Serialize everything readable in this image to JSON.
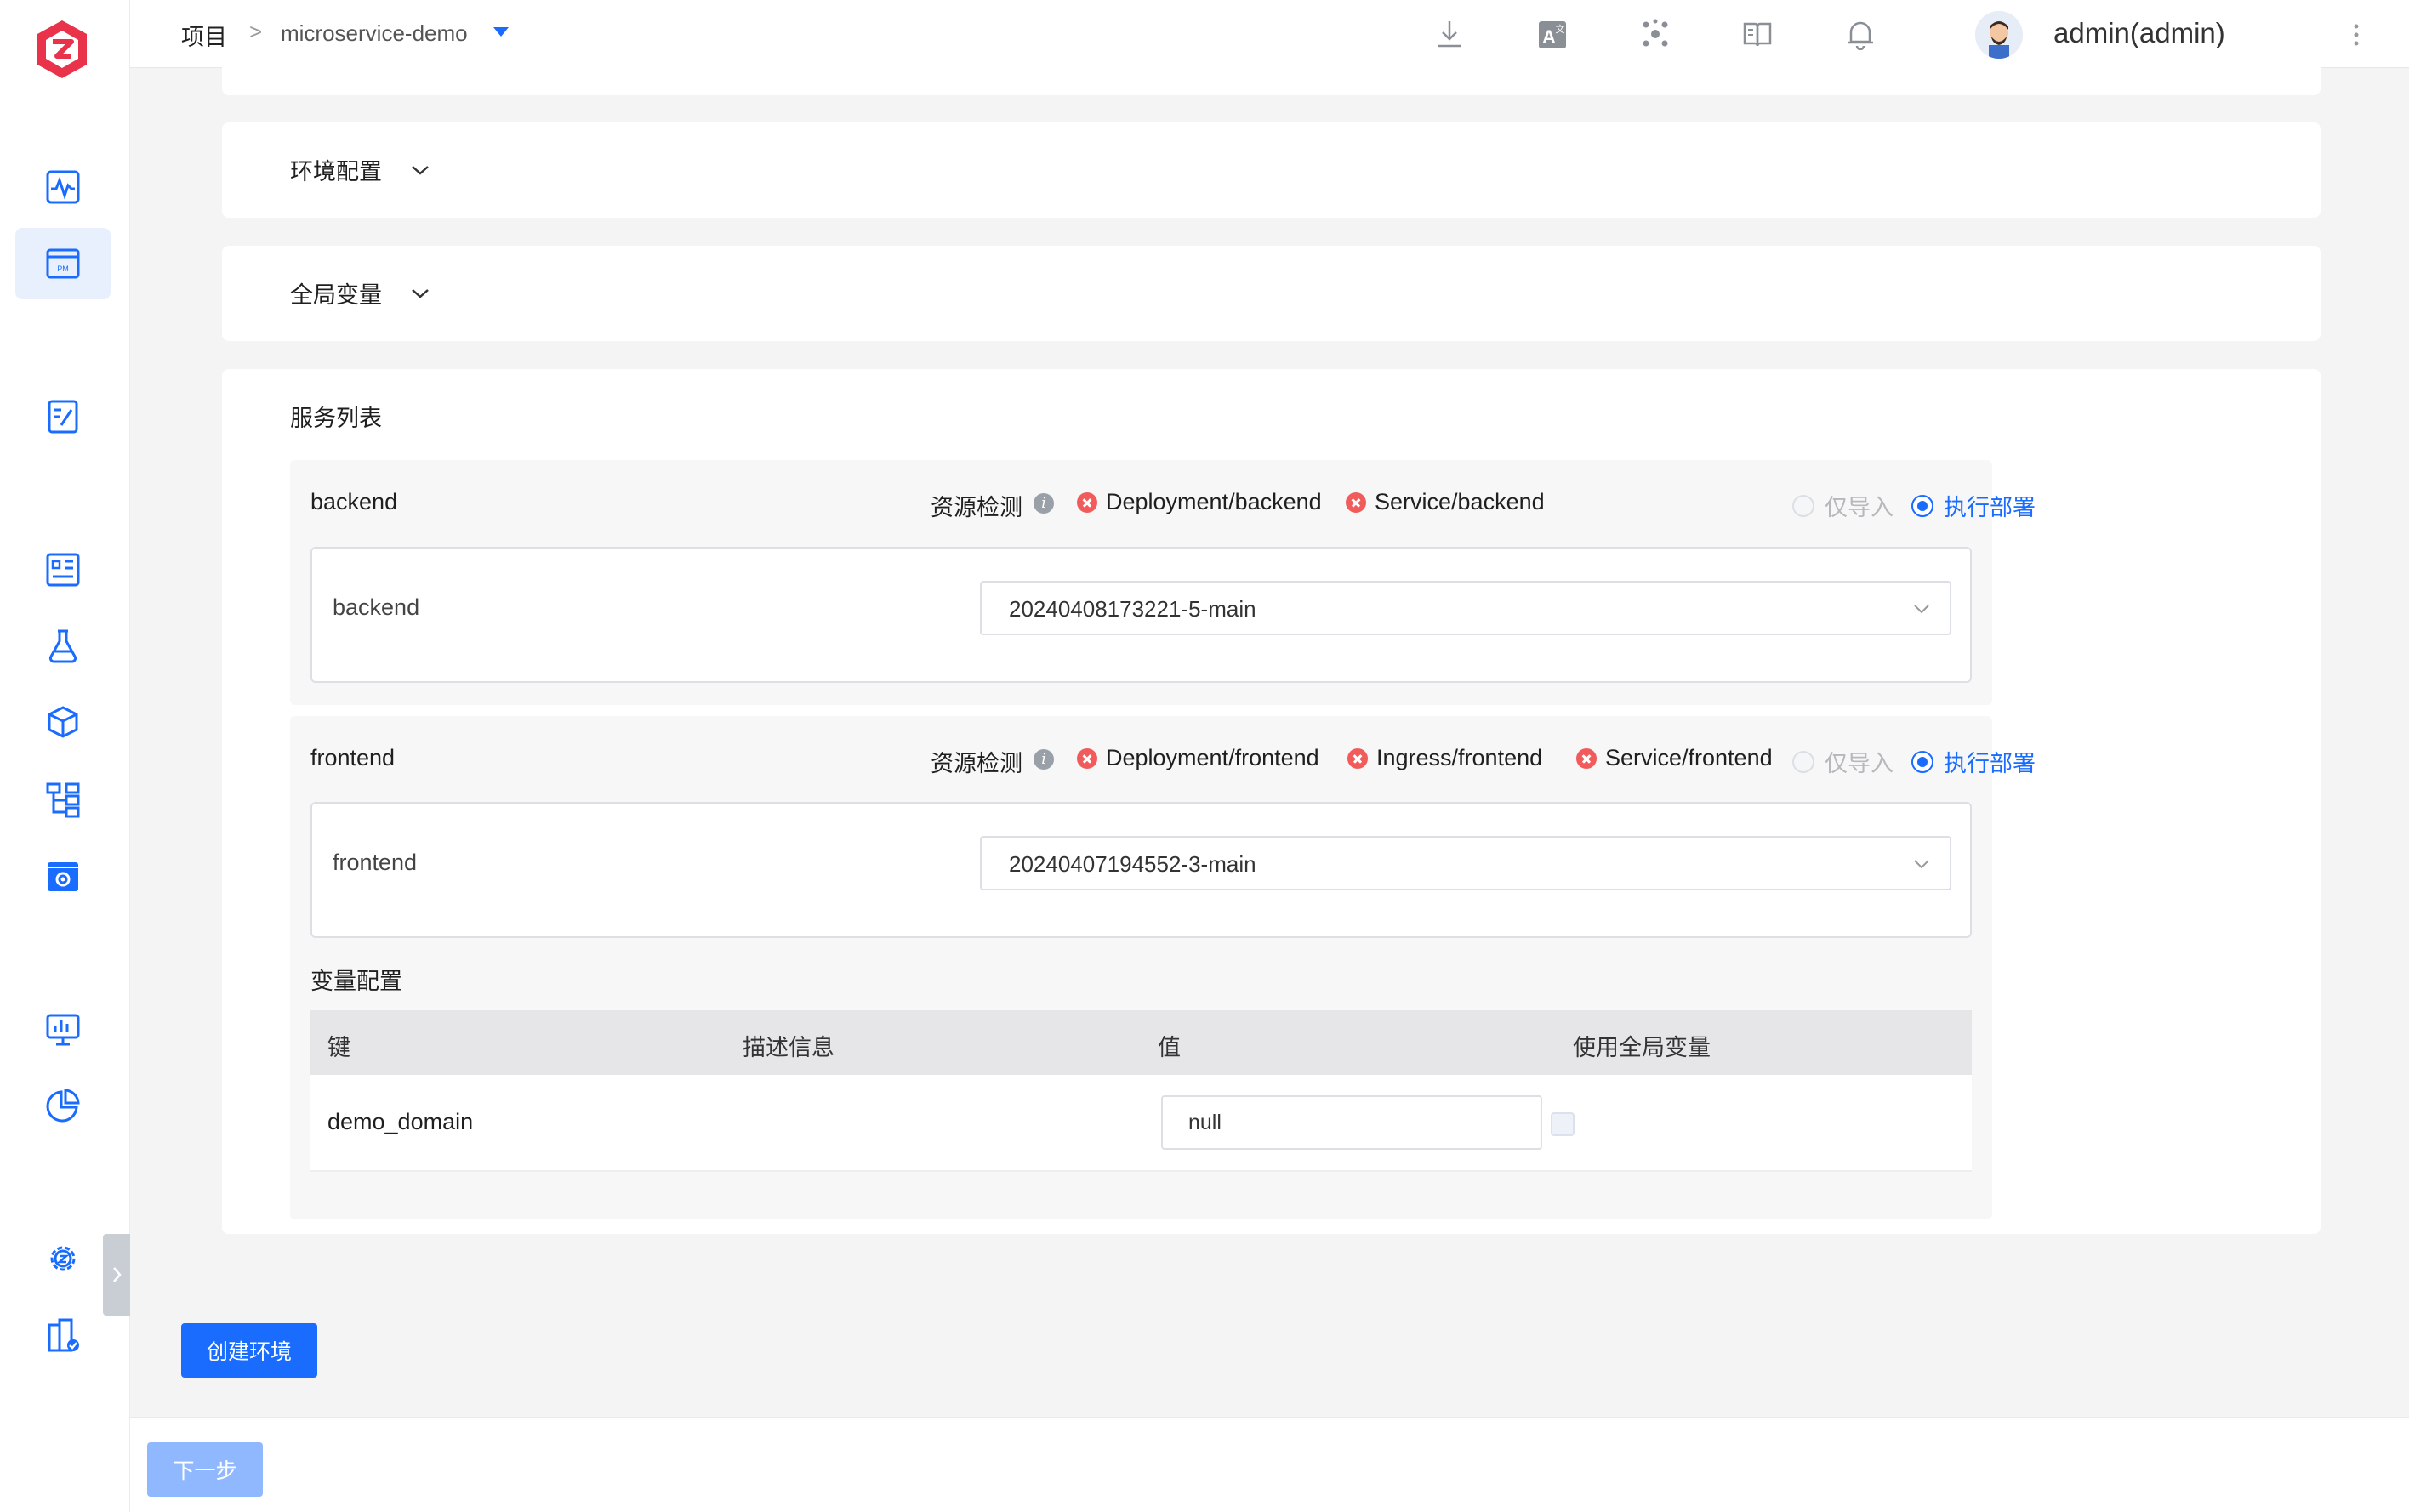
{
  "header": {
    "breadcrumb_root": "项目",
    "breadcrumb_sep": ">",
    "project_name": "microservice-demo",
    "username": "admin(admin)"
  },
  "sections": {
    "env_config": "环境配置",
    "global_vars": "全局变量",
    "service_list": "服务列表"
  },
  "services": [
    {
      "name": "backend",
      "resource_check_label": "资源检测",
      "resources": [
        "Deployment/backend",
        "Service/backend"
      ],
      "radio_import_only": "仅导入",
      "radio_deploy": "执行部署",
      "component": "backend",
      "image_tag": "20240408173221-5-main"
    },
    {
      "name": "frontend",
      "resource_check_label": "资源检测",
      "resources": [
        "Deployment/frontend",
        "Ingress/frontend",
        "Service/frontend"
      ],
      "radio_import_only": "仅导入",
      "radio_deploy": "执行部署",
      "component": "frontend",
      "image_tag": "20240407194552-3-main",
      "var_config": {
        "title": "变量配置",
        "columns": [
          "键",
          "描述信息",
          "值",
          "使用全局变量"
        ],
        "rows": [
          {
            "key": "demo_domain",
            "description": "",
            "value": "null",
            "use_global": false
          }
        ]
      }
    }
  ],
  "buttons": {
    "create_env": "创建环境",
    "next_step": "下一步"
  },
  "colors": {
    "primary": "#1a6cff",
    "error": "#f25b5b",
    "brand": "#e8334a"
  },
  "icons": {
    "sidebar": [
      "monitor-wave-icon",
      "project-pm-icon",
      "document-edit-icon",
      "report-icon",
      "flask-icon",
      "package-icon",
      "workflow-icon",
      "settings-box-icon",
      "dashboard-icon",
      "pie-chart-icon",
      "gear-icon",
      "building-check-icon"
    ],
    "header": [
      "download-icon",
      "translate-icon",
      "cluster-icon",
      "book-icon",
      "bell-icon"
    ]
  }
}
